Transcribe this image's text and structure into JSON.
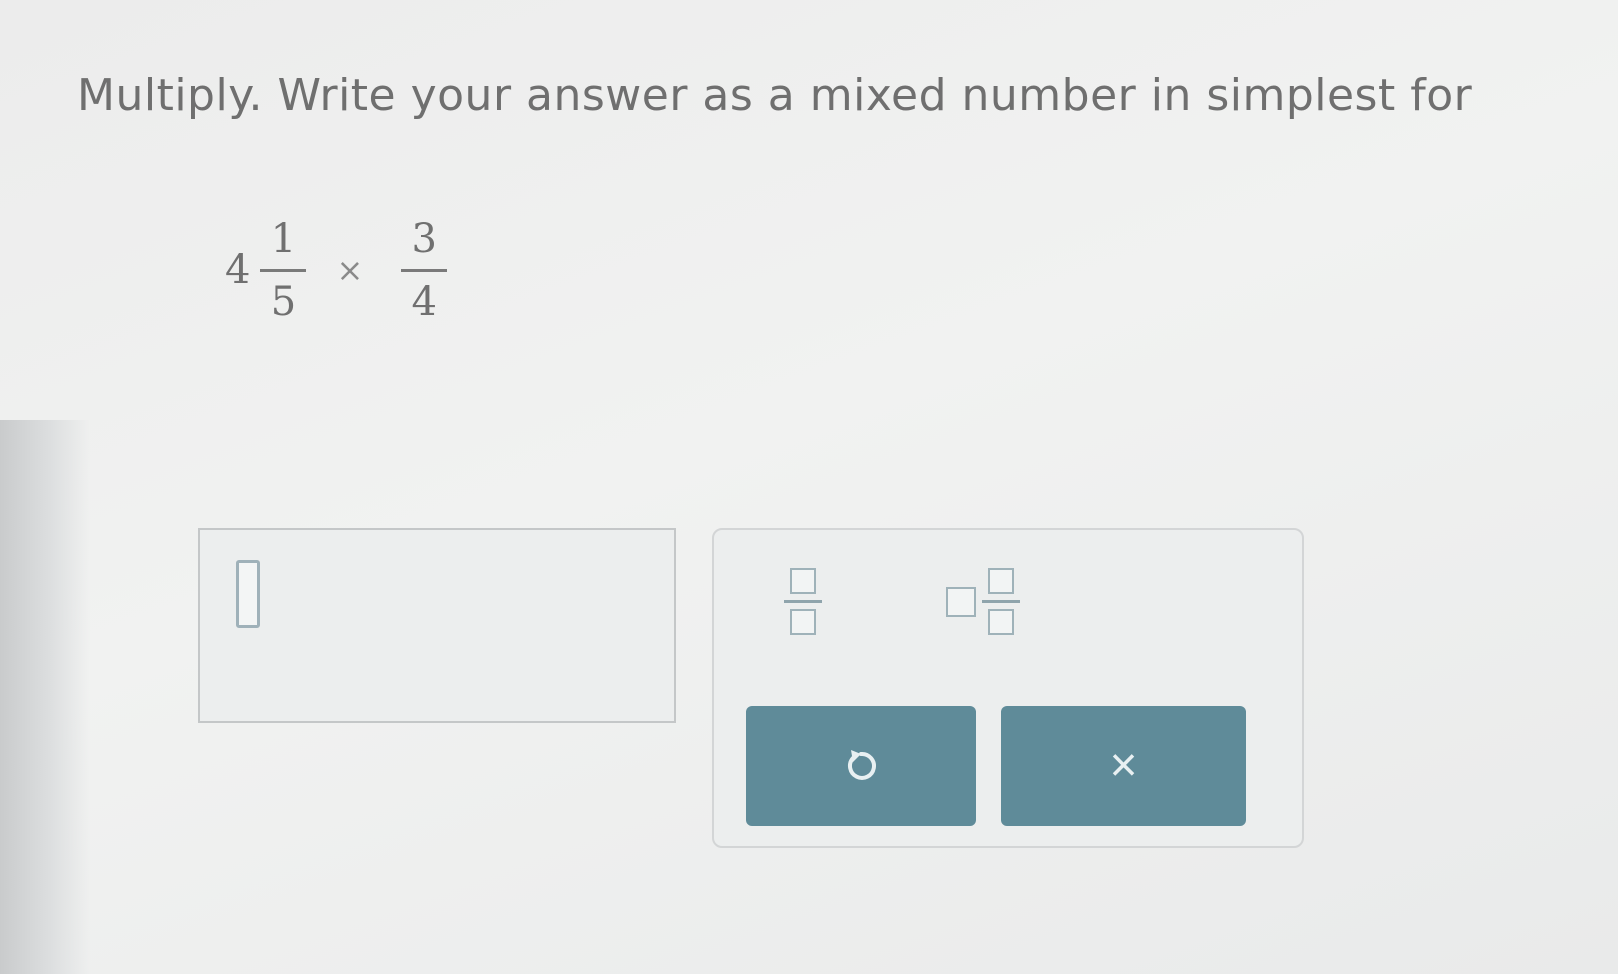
{
  "question": {
    "instruction": "Multiply. Write your answer as a mixed number in simplest for",
    "expression": {
      "whole": "4",
      "fraction1": {
        "numerator": "1",
        "denominator": "5"
      },
      "operator": "×",
      "fraction2": {
        "numerator": "3",
        "denominator": "4"
      }
    }
  },
  "answer": {
    "value": ""
  },
  "keypad": {
    "templates": [
      "fraction-template-icon",
      "mixed-number-template-icon"
    ],
    "buttons": {
      "undo": "undo-icon",
      "clear": "×"
    }
  },
  "colors": {
    "button_bg": "#5f8b99",
    "text": "#6f6f6f",
    "template_outline": "#9fb2b9"
  }
}
